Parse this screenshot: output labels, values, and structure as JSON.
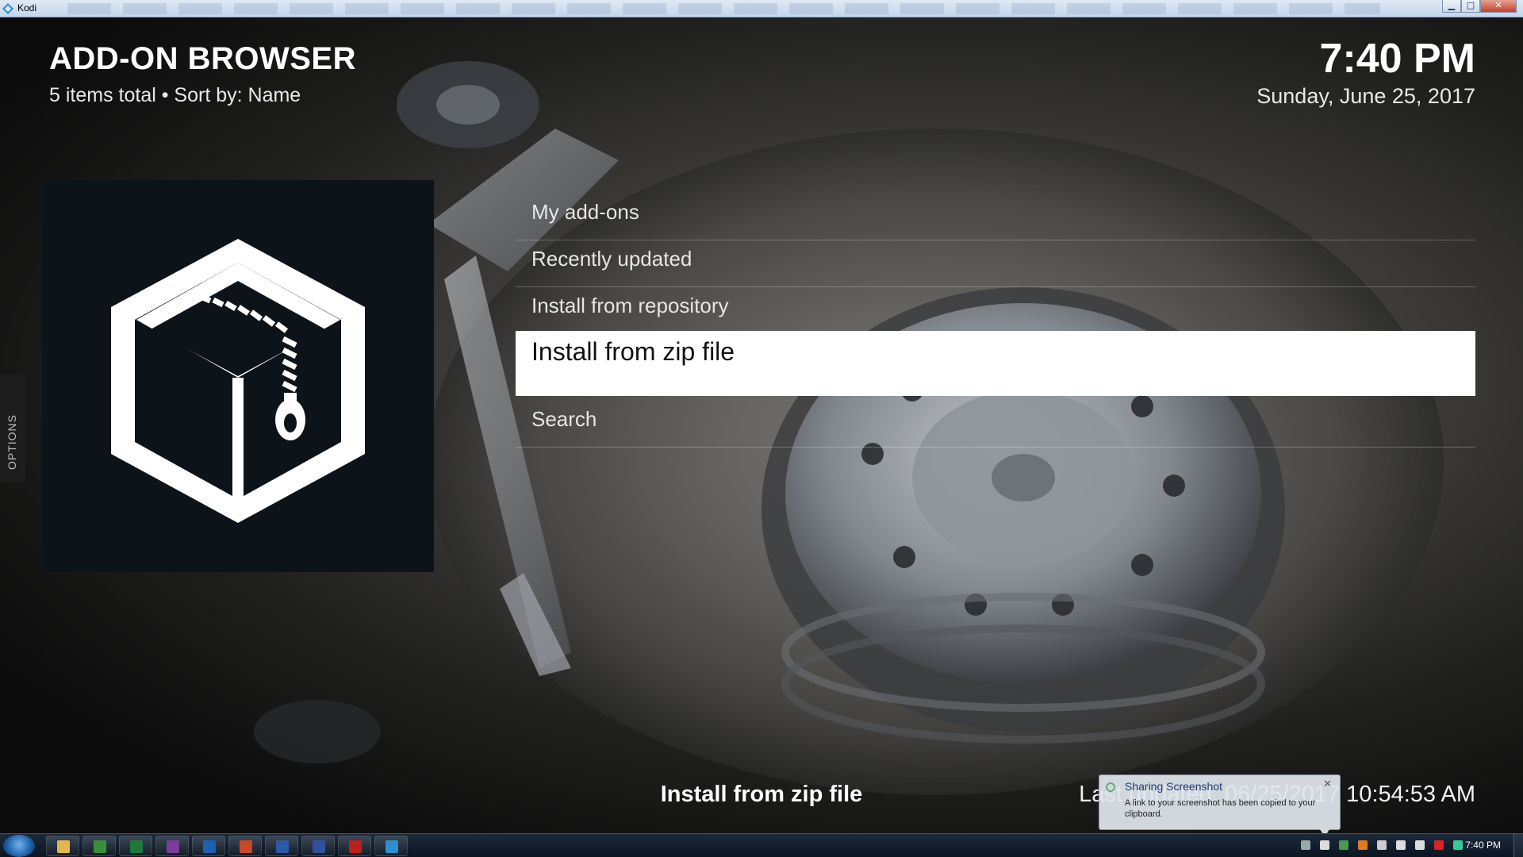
{
  "window": {
    "title": "Kodi",
    "minimize_glyph": "▁",
    "maximize_glyph": "□",
    "close_glyph": "✕"
  },
  "header": {
    "title": "ADD-ON BROWSER",
    "subtitle": "5 items total • Sort by: Name",
    "time": "7:40 PM",
    "date": "Sunday, June 25, 2017"
  },
  "side_tab": {
    "label": "OPTIONS"
  },
  "menu": {
    "items": [
      {
        "label": "My add-ons",
        "selected": false
      },
      {
        "label": "Recently updated",
        "selected": false
      },
      {
        "label": "Install from repository",
        "selected": false
      },
      {
        "label": "Install from zip file",
        "selected": true
      },
      {
        "label": "Search",
        "selected": false
      }
    ]
  },
  "footer": {
    "selected_title": "Install from zip file",
    "last_updated": "Last updated: 06/25/2017 10:54:53 AM"
  },
  "notification": {
    "title": "Sharing Screenshot",
    "text": "A link to your screenshot has been copied to your clipboard.",
    "close_glyph": "✕"
  },
  "taskbar": {
    "clock": "7:40 PM",
    "apps": [
      {
        "name": "explorer",
        "color": "#e2b84c"
      },
      {
        "name": "chrome",
        "color": "#3a8f3c"
      },
      {
        "name": "excel",
        "color": "#1e7a3c"
      },
      {
        "name": "onenote",
        "color": "#7b3c9c"
      },
      {
        "name": "outlook",
        "color": "#1f5fb0"
      },
      {
        "name": "powerpoint",
        "color": "#c8482a"
      },
      {
        "name": "word",
        "color": "#2b5aa8"
      },
      {
        "name": "visio",
        "color": "#3050a0"
      },
      {
        "name": "filezilla",
        "color": "#b8211c"
      },
      {
        "name": "kodi",
        "color": "#2d8fd0"
      }
    ]
  },
  "colors": {
    "selected_bg": "#ffffff",
    "selected_text": "#111111",
    "icon_panel_bg": "#0d1419"
  }
}
